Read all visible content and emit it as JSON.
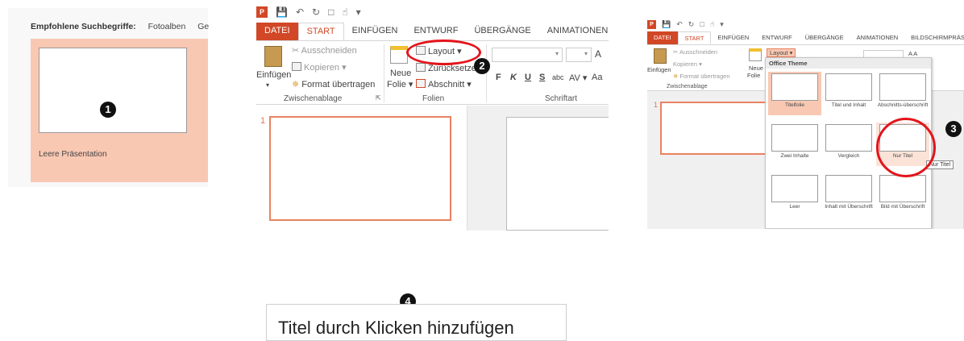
{
  "panel1": {
    "suggest_label": "Empfohlene Suchbegriffe:",
    "suggest_items": [
      "Fotoalben",
      "Ge"
    ],
    "tile_label": "Leere Präsentation",
    "step": "1"
  },
  "panel2": {
    "logo": "P",
    "tabs": [
      "DATEI",
      "START",
      "EINFÜGEN",
      "ENTWURF",
      "ÜBERGÄNGE",
      "ANIMATIONEN"
    ],
    "clipboard": {
      "paste": "Einfügen",
      "cut": "Ausschneiden",
      "copy": "Kopieren",
      "format": "Format übertragen",
      "group": "Zwischenablage"
    },
    "slides": {
      "new_slide_1": "Neue",
      "new_slide_2": "Folie",
      "layout": "Layout",
      "reset": "Zurücksetzen",
      "section": "Abschnitt",
      "group": "Folien"
    },
    "font": {
      "group": "Schriftart",
      "bold": "F",
      "italic": "K",
      "underline": "U",
      "strike": "S",
      "abc": "abc",
      "spacing": "AV",
      "case": "Aa",
      "grow": "A"
    },
    "slide_number": "1",
    "step": "2"
  },
  "panel3": {
    "tabs": [
      "DATEI",
      "START",
      "EINFÜGEN",
      "ENTWURF",
      "ÜBERGÄNGE",
      "ANIMATIONEN",
      "BILDSCHIRMPRÄSE"
    ],
    "clipboard": {
      "paste": "Einfügen",
      "cut": "Ausschneiden",
      "copy": "Kopieren",
      "format": "Format übertragen",
      "group": "Zwischenablage"
    },
    "new_slide_1": "Neue",
    "new_slide_2": "Folie",
    "layout_button": "Layout",
    "gallery_title": "Office Theme",
    "layouts": [
      "Titelfolie",
      "Titel und Inhalt",
      "Abschnitts-überschrift",
      "Zwei Inhalte",
      "Vergleich",
      "Nur Titel",
      "Leer",
      "Inhalt mit Überschrift",
      "Bild mit Überschrift"
    ],
    "tooltip": "Nur Titel",
    "slide_number": "1",
    "step": "3"
  },
  "panel4": {
    "title_placeholder": "Titel durch Klicken hinzufügen",
    "step": "4"
  }
}
